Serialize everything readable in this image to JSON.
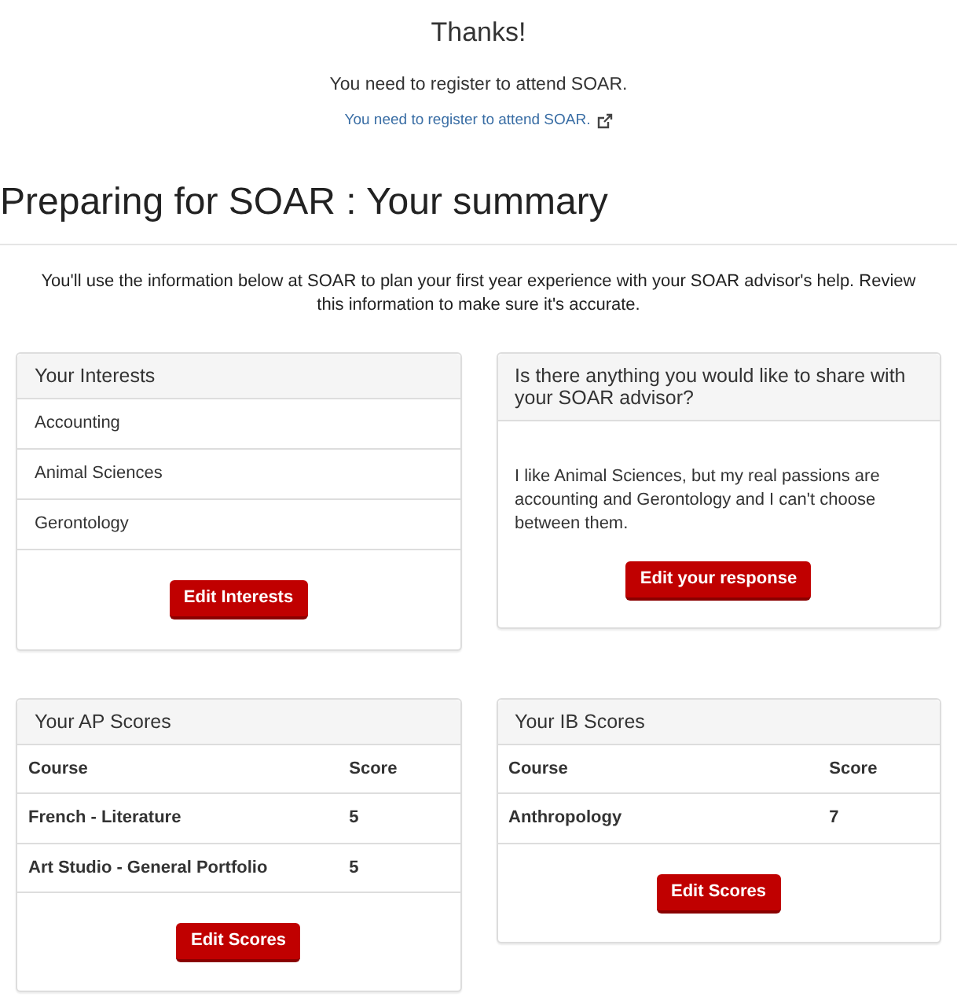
{
  "thanks": {
    "title": "Thanks!",
    "message": "You need to register to attend SOAR.",
    "link": "You need to register to attend SOAR."
  },
  "page_title": "Preparing for SOAR : Your summary",
  "intro": "You'll use the information below at SOAR to plan your first year experience with your SOAR advisor's help. Review this information to make sure it's accurate.",
  "interests": {
    "title": "Your Interests",
    "items": [
      "Accounting",
      "Animal Sciences",
      "Gerontology"
    ],
    "button": "Edit Interests"
  },
  "share": {
    "title": "Is there anything you would like to share with your SOAR advisor?",
    "response": "I like Animal Sciences, but my real passions are accounting and Gerontology and I can't choose between them.",
    "button": "Edit your response"
  },
  "ap_scores": {
    "title": "Your AP Scores",
    "columns": [
      "Course",
      "Score"
    ],
    "rows": [
      [
        "French - Literature",
        "5"
      ],
      [
        "Art Studio - General Portfolio",
        "5"
      ]
    ],
    "button": "Edit Scores"
  },
  "ib_scores": {
    "title": "Your IB Scores",
    "columns": [
      "Course",
      "Score"
    ],
    "rows": [
      [
        "Anthropology",
        "7"
      ]
    ],
    "button": "Edit Scores"
  }
}
